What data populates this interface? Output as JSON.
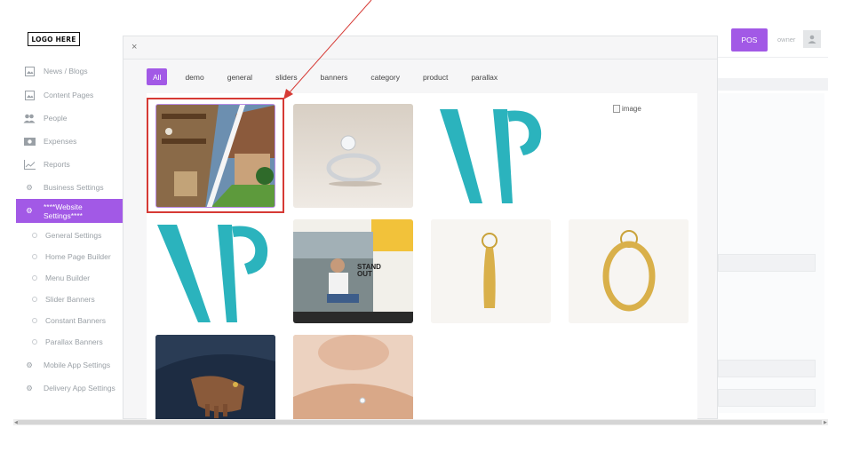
{
  "logo": {
    "text": "LOGO HERE"
  },
  "sidebar": {
    "items": [
      {
        "label": "News / Blogs",
        "icon": "image-icon"
      },
      {
        "label": "Content Pages",
        "icon": "image-icon"
      },
      {
        "label": "People",
        "icon": "people-icon"
      },
      {
        "label": "Expenses",
        "icon": "money-icon"
      },
      {
        "label": "Reports",
        "icon": "chart-line-icon"
      },
      {
        "label": "Business Settings",
        "icon": "gears-icon"
      },
      {
        "label": "****Website Settings****",
        "icon": "gears-icon",
        "active": true
      },
      {
        "label": "Mobile App Settings",
        "icon": "gears-icon"
      },
      {
        "label": "Delivery App Settings",
        "icon": "gears-icon"
      }
    ],
    "subitems": [
      {
        "label": "General Settings"
      },
      {
        "label": "Home Page Builder"
      },
      {
        "label": "Menu Builder"
      },
      {
        "label": "Slider Banners"
      },
      {
        "label": "Constant Banners"
      },
      {
        "label": "Parallax Banners"
      }
    ]
  },
  "header": {
    "pos_label": "POS",
    "user_label": "owner"
  },
  "modal": {
    "close": "×",
    "filters": [
      "All",
      "demo",
      "general",
      "sliders",
      "banners",
      "category",
      "product",
      "parallax"
    ],
    "active_filter": "All",
    "broken_image_alt": "image"
  },
  "colors": {
    "accent": "#a259e6",
    "highlight": "#d63a35",
    "wp_teal": "#2bb3bd"
  }
}
